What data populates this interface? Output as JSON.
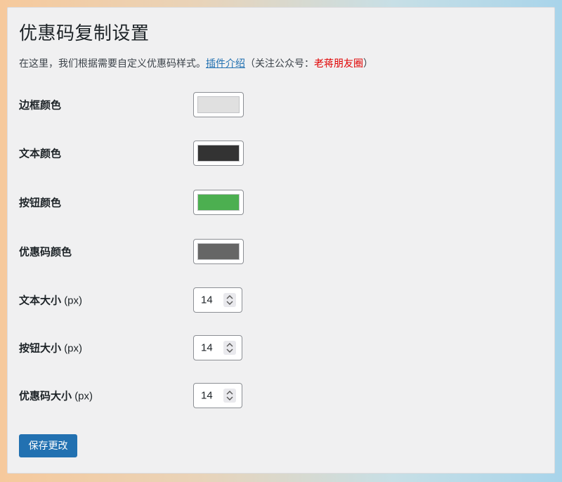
{
  "page": {
    "title": "优惠码复制设置",
    "intro_text": "在这里，我们根据需要自定义优惠码样式。",
    "plugin_link": "插件介绍",
    "follow_prefix": "（关注公众号：",
    "follow_account": "老蒋朋友圈",
    "follow_suffix": "）"
  },
  "color_settings": [
    {
      "label": "边框颜色",
      "color": "#e0e0e0"
    },
    {
      "label": "文本颜色",
      "color": "#333333"
    },
    {
      "label": "按钮颜色",
      "color": "#4caf50"
    },
    {
      "label": "优惠码颜色",
      "color": "#666666"
    }
  ],
  "size_settings": [
    {
      "label": "文本大小",
      "unit": "(px)",
      "value": "14"
    },
    {
      "label": "按钮大小",
      "unit": "(px)",
      "value": "14"
    },
    {
      "label": "优惠码大小",
      "unit": "(px)",
      "value": "14"
    }
  ],
  "actions": {
    "save_label": "保存更改"
  },
  "colors": {
    "accent": "#2271b1",
    "highlight_red": "#e00000"
  }
}
